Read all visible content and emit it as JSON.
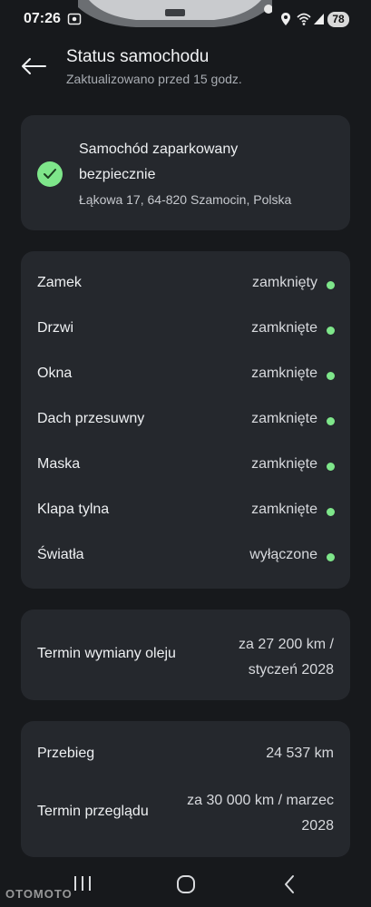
{
  "status_bar": {
    "time": "07:26",
    "battery": "78"
  },
  "header": {
    "title": "Status samochodu",
    "subtitle": "Zaktualizowano przed 15 godz."
  },
  "parked": {
    "title": "Samochód zaparkowany bezpiecznie",
    "address": "Łąkowa 17, 64-820 Szamocin, Polska"
  },
  "status_items": [
    {
      "label": "Zamek",
      "value": "zamknięty"
    },
    {
      "label": "Drzwi",
      "value": "zamknięte"
    },
    {
      "label": "Okna",
      "value": "zamknięte"
    },
    {
      "label": "Dach przesuwny",
      "value": "zamknięte"
    },
    {
      "label": "Maska",
      "value": "zamknięte"
    },
    {
      "label": "Klapa tylna",
      "value": "zamknięte"
    },
    {
      "label": "Światła",
      "value": "wyłączone"
    }
  ],
  "oil": {
    "label": "Termin wymiany oleju",
    "value": "za 27 200 km / styczeń 2028"
  },
  "mileage": {
    "label": "Przebieg",
    "value": "24 537 km"
  },
  "inspection": {
    "label": "Termin przeglądu",
    "value": "za 30 000 km / marzec 2028"
  },
  "watermark": "OTOMOTO",
  "colors": {
    "background": "#17191c",
    "card": "#25282d",
    "ok_green": "#7ee68a"
  },
  "icons": [
    "screenshot-icon",
    "location-icon",
    "wifi-icon",
    "signal-icon",
    "back-arrow-icon",
    "checkmark-icon",
    "recent-apps-icon",
    "home-icon",
    "back-nav-icon"
  ]
}
